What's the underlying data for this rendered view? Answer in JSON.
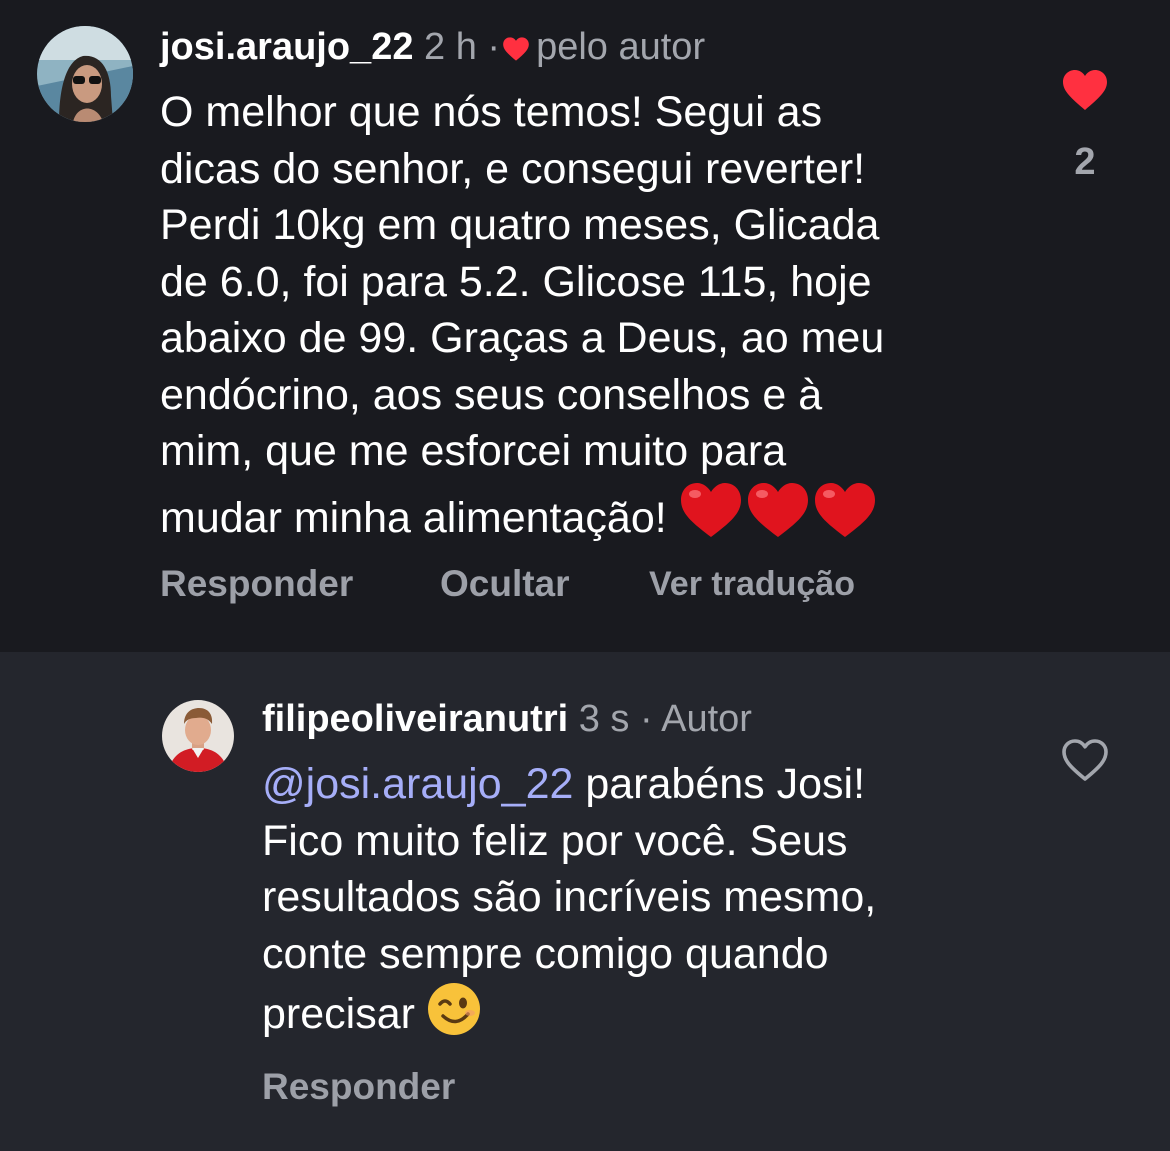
{
  "comment": {
    "username": "josi.araujo_22",
    "time": "2 h",
    "separator": "·",
    "liked_by_author": "pelo autor",
    "lines": [
      "O melhor que nós temos! Segui as",
      "dicas do senhor, e consegui reverter!",
      "Perdi 10kg em quatro meses, Glicada",
      "de 6.0, foi para 5.2. Glicose 115, hoje",
      "abaixo de 99. Graças a Deus, ao meu",
      "endócrino, aos seus conselhos e à",
      "mim, que me esforcei muito para",
      "mudar minha alimentação!"
    ],
    "trailing_emoji": "❤️ ❤️ ❤️",
    "like_count": "2",
    "liked": true,
    "actions": {
      "reply": "Responder",
      "hide": "Ocultar",
      "translate": "Ver tradução"
    }
  },
  "reply": {
    "username": "filipeoliveiranutri",
    "time": "3 s",
    "separator": "·",
    "author_badge": "Autor",
    "mention": "@josi.araujo_22",
    "first_line_rest": " parabéns Josi!",
    "lines": [
      "Fico muito feliz por você. Seus",
      "resultados são incríveis mesmo,",
      "conte sempre comigo quando"
    ],
    "last_line": "precisar",
    "trailing_emoji": "😉",
    "liked": false,
    "actions": {
      "reply": "Responder"
    }
  },
  "colors": {
    "like_red": "#ff3040",
    "mention": "#a6aef8",
    "muted": "#a3a6ad"
  }
}
